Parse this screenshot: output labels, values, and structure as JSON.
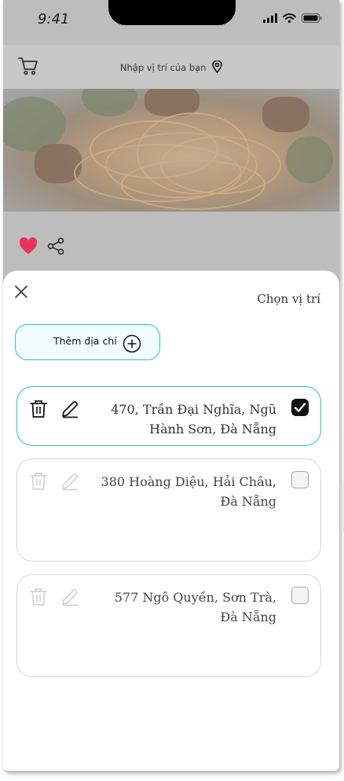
{
  "status_bar": {
    "time": "9:41"
  },
  "header": {
    "location_label": "Nhập vị trí của bạn"
  },
  "sheet": {
    "title": "Chọn vị trí",
    "add_address_label": "Thêm địa chỉ",
    "addresses": [
      {
        "text": "470, Trần Đại Nghĩa, Ngũ Hành Sơn, Đà Nẵng",
        "selected": true
      },
      {
        "text": "380 Hoàng Diệu, Hải Châu, Đà Nẵng",
        "selected": false
      },
      {
        "text": "577 Ngô Quyền, Sơn Trà, Đà Nẵng",
        "selected": false
      }
    ]
  },
  "colors": {
    "accent": "#26c6c6",
    "heart": "#e8335a",
    "overlay": "#bdbdbd"
  },
  "icons": [
    "cart-icon",
    "location-pin-icon",
    "heart-icon",
    "share-icon",
    "close-icon",
    "plus-circle-icon",
    "trash-icon",
    "pencil-icon",
    "checkbox-icon"
  ]
}
